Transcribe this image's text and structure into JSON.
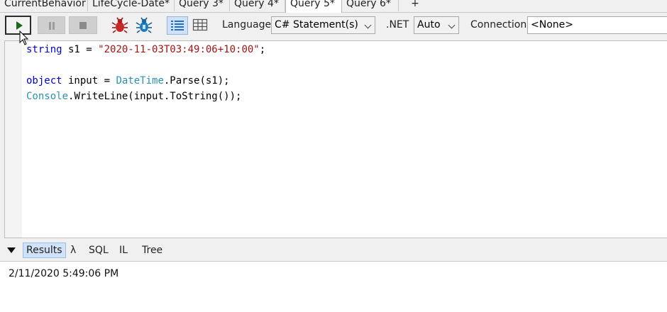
{
  "tabs": [
    {
      "label": "CurrentBehavior",
      "active": false
    },
    {
      "label": "LifeCycle-Date*",
      "active": false
    },
    {
      "label": "Query 3*",
      "active": false
    },
    {
      "label": "Query 4*",
      "active": false
    },
    {
      "label": "Query 5*",
      "active": true
    },
    {
      "label": "Query 6*",
      "active": false
    },
    {
      "label": "+",
      "active": false
    }
  ],
  "toolbar": {
    "run_icon": "play-icon",
    "pause_icon": "pause-icon",
    "stop_icon": "stop-icon",
    "debug_icon": "bug-red-icon",
    "debug2_icon": "bug-blue-icon",
    "results_rich_icon": "results-rich-icon",
    "results_grid_icon": "results-grid-icon",
    "language_label": "Language",
    "language_value": "C# Statement(s)",
    "dotnet_label": ".NET",
    "dotnet_value": "Auto",
    "connection_label": "Connection",
    "connection_value": "<None>"
  },
  "editor": {
    "lines": [
      "string s1 = \"2020-11-03T03:49:06+10:00\";",
      "",
      "object input = DateTime.Parse(s1);",
      "Console.WriteLine(input.ToString());"
    ],
    "tokens": {
      "l1_kw": "string",
      "l1_mid": " s1 = ",
      "l1_str": "\"2020-11-03T03:49:06+10:00\"",
      "l1_end": ";",
      "l3_kw": "object",
      "l3_mid": " input = ",
      "l3_typ": "DateTime",
      "l3_end": ".Parse(s1);",
      "l4_typ": "Console",
      "l4_end": ".WriteLine(input.ToString());"
    }
  },
  "result_tabs": {
    "collapse_icon": "triangle-down-icon",
    "items": [
      "Results",
      "λ",
      "SQL",
      "IL",
      "Tree"
    ]
  },
  "results": {
    "value": "2/11/2020 5:49:06 PM"
  },
  "colors": {
    "keyword": "#0000c8",
    "string": "#a31515",
    "type": "#2b91af",
    "active_tab_bg": "#cfe2f7"
  }
}
